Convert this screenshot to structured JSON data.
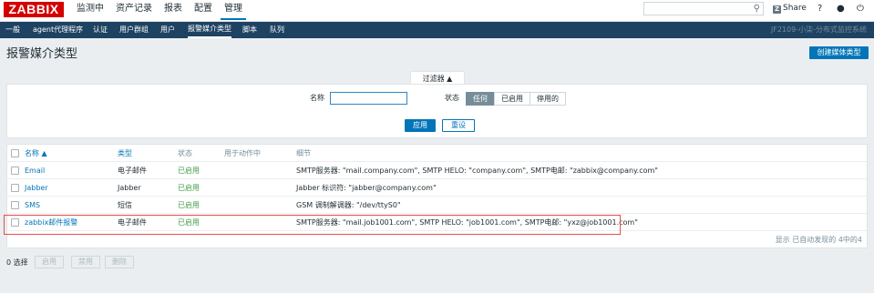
{
  "logo": "ZABBIX",
  "main_menu": [
    "监测中",
    "资产记录",
    "报表",
    "配置",
    "管理"
  ],
  "header_tools": {
    "share_label": "Share",
    "help": "?",
    "user": "👤",
    "logout": "⏻",
    "search_icon": "🔍"
  },
  "sub_menu": [
    "一般",
    "agent代理程序",
    "认证",
    "用户群组",
    "用户",
    "报警媒介类型",
    "脚本",
    "队列"
  ],
  "server_name": "JF2109-小柒-分布式监控系统",
  "page": {
    "title": "报警媒介类型",
    "create_button": "创建媒体类型"
  },
  "filter": {
    "tab_label": "过滤器 ▲",
    "name_label": "名称",
    "name_value": "",
    "status_label": "状态",
    "status_options": [
      "任何",
      "已启用",
      "停用的"
    ],
    "status_selected": "任何",
    "apply_label": "应用",
    "reset_label": "重设"
  },
  "table": {
    "columns": [
      "名称 ▲",
      "类型",
      "状态",
      "用于动作中",
      "细节"
    ],
    "rows": [
      {
        "name": "Email",
        "type": "电子邮件",
        "status": "已启用",
        "used_in": "",
        "details": "SMTP服务器: \"mail.company.com\", SMTP HELO: \"company.com\", SMTP电邮: \"zabbix@company.com\""
      },
      {
        "name": "Jabber",
        "type": "Jabber",
        "status": "已启用",
        "used_in": "",
        "details": "Jabber 标识符: \"jabber@company.com\""
      },
      {
        "name": "SMS",
        "type": "短信",
        "status": "已启用",
        "used_in": "",
        "details": "GSM 调制解调器: \"/dev/ttyS0\""
      },
      {
        "name": "zabbix邮件报警",
        "type": "电子邮件",
        "status": "已启用",
        "used_in": "",
        "details": "SMTP服务器: \"mail.job1001.com\", SMTP HELO: \"job1001.com\", SMTP电邮: \"yxz@job1001.com\""
      }
    ],
    "footer": "显示 已自动发现的 4中的4"
  },
  "bottom": {
    "selected": "0 选择",
    "buttons": [
      "启用",
      "禁用",
      "删除"
    ]
  }
}
